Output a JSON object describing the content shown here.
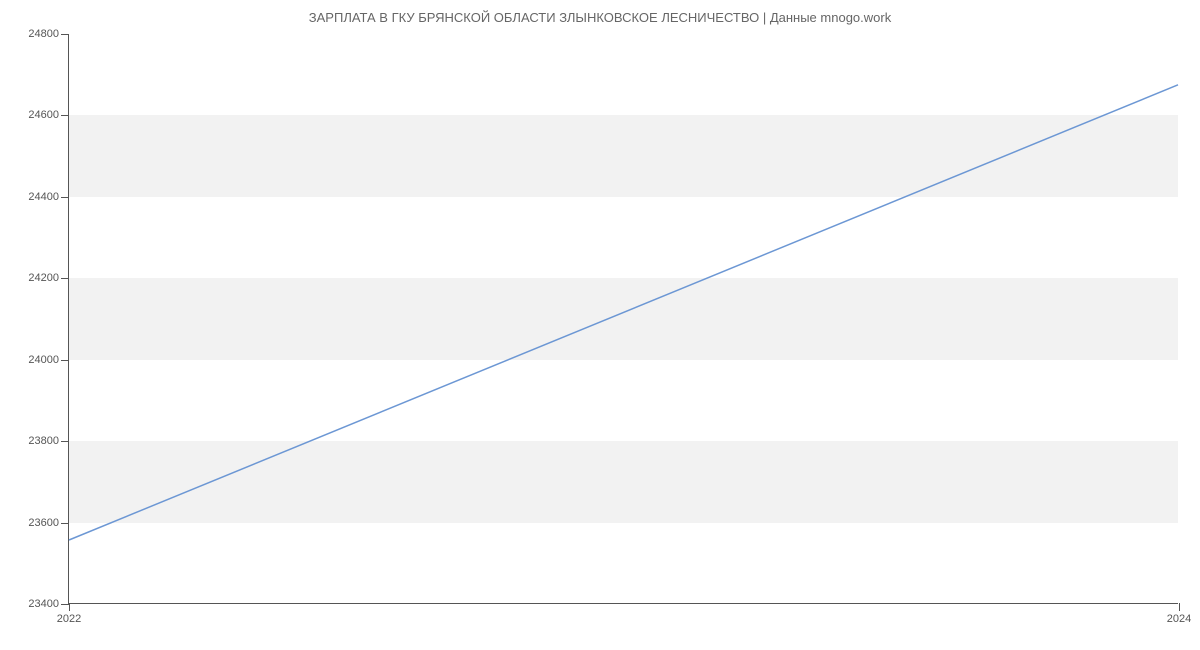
{
  "chart_data": {
    "type": "line",
    "title": "ЗАРПЛАТА В ГКУ БРЯНСКОЙ ОБЛАСТИ ЗЛЫНКОВСКОЕ ЛЕСНИЧЕСТВО | Данные mnogo.work",
    "x": [
      2022,
      2024
    ],
    "values": [
      23555,
      24675
    ],
    "xlabel": "",
    "ylabel": "",
    "xlim": [
      2022,
      2024
    ],
    "ylim": [
      23400,
      24800
    ],
    "x_ticks": [
      2022,
      2024
    ],
    "y_ticks": [
      23400,
      23600,
      23800,
      24000,
      24200,
      24400,
      24600,
      24800
    ],
    "line_color": "#6c97d4",
    "band_color": "#f2f2f2"
  }
}
